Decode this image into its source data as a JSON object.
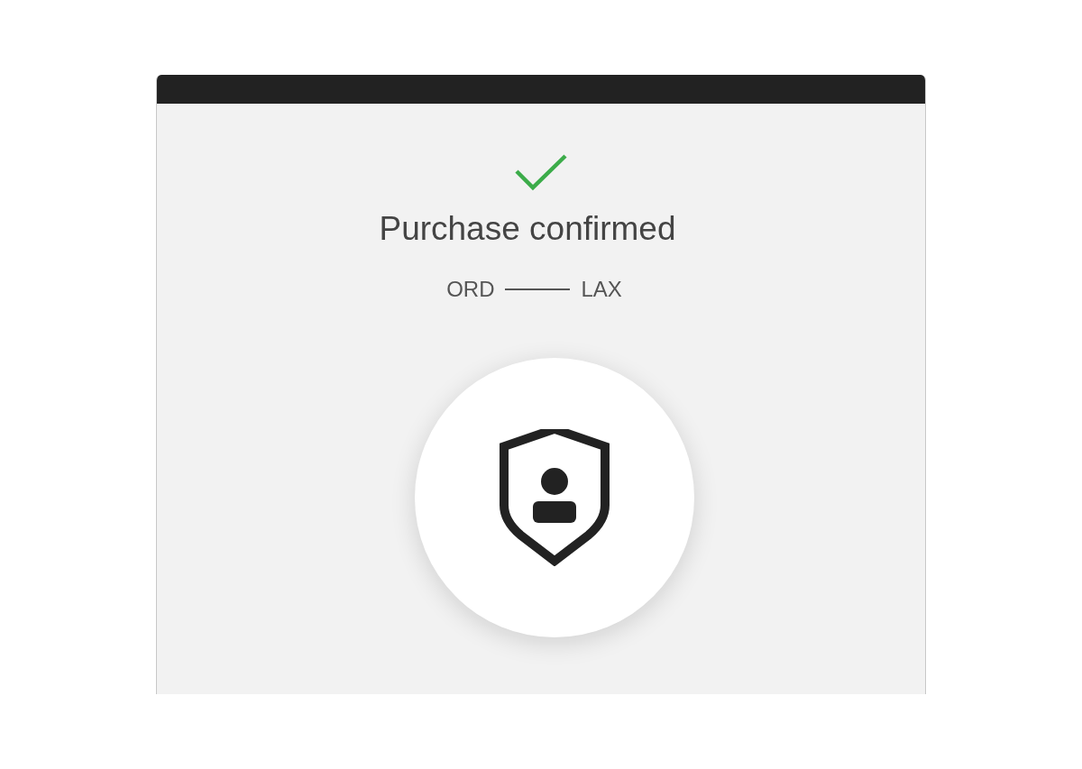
{
  "title": "Purchase confirmed",
  "route": {
    "origin": "ORD",
    "destination": "LAX"
  }
}
